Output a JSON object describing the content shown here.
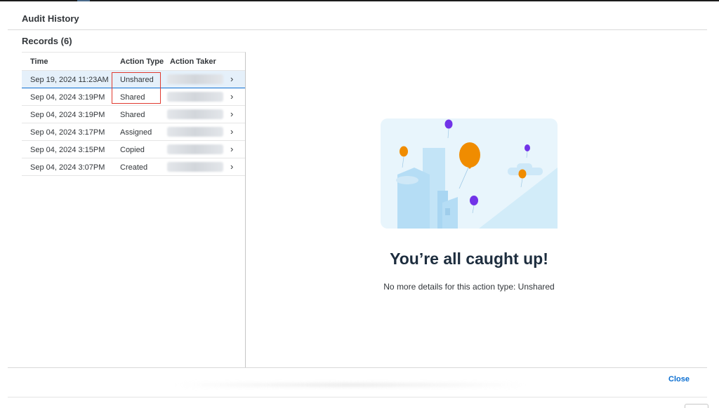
{
  "dialog": {
    "title": "Audit History",
    "close_label": "Close"
  },
  "records": {
    "title": "Records (6)",
    "columns": [
      "Time",
      "Action Type",
      "Action Taker"
    ],
    "rows": [
      {
        "time": "Sep 19, 2024 11:23AM",
        "action": "Unshared",
        "selected": true
      },
      {
        "time": "Sep 04, 2024 3:19PM",
        "action": "Shared",
        "selected": false
      },
      {
        "time": "Sep 04, 2024 3:19PM",
        "action": "Shared",
        "selected": false
      },
      {
        "time": "Sep 04, 2024 3:17PM",
        "action": "Assigned",
        "selected": false
      },
      {
        "time": "Sep 04, 2024 3:15PM",
        "action": "Copied",
        "selected": false
      },
      {
        "time": "Sep 04, 2024 3:07PM",
        "action": "Created",
        "selected": false
      }
    ]
  },
  "detail": {
    "illustration": "balloons-city-illustration",
    "empty_title": "You’re all caught up!",
    "empty_message": "No more details for this action type: Unshared"
  },
  "colors": {
    "accent": "#0a6ed1",
    "selected_row": "#e5f0fa",
    "highlight": "#e03a2f",
    "balloon_orange": "#f08c00",
    "balloon_purple": "#7133e8"
  }
}
